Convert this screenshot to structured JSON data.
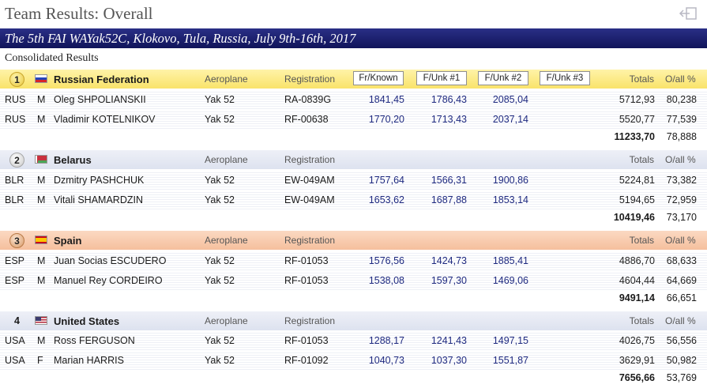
{
  "header": {
    "title": "Team Results: Overall"
  },
  "event": {
    "title": "The 5th FAI WAYak52C, Klokovo, Tula, Russia, July 9th-16th, 2017"
  },
  "subtitle": "Consolidated Results",
  "columns": {
    "aeroplane": "Aeroplane",
    "registration": "Registration",
    "fr_known": "Fr/Known",
    "f_unk1": "F/Unk #1",
    "f_unk2": "F/Unk #2",
    "f_unk3": "F/Unk #3",
    "totals": "Totals",
    "oall_pct": "O/all %"
  },
  "colors": {
    "event_bar": "#10145a",
    "score_blue": "#1f2a80",
    "gold": "#f9e36a",
    "silver": "#dde2ef",
    "bronze": "#f5bf9d"
  },
  "teams": [
    {
      "rank": "1",
      "name": "Russian Federation",
      "flag": "russia-flag",
      "pilots": [
        {
          "code": "RUS",
          "gender": "M",
          "name": "Oleg SHPOLIANSKII",
          "aeroplane": "Yak 52",
          "registration": "RA-0839G",
          "fr_known": "1841,45",
          "f_unk1": "1786,43",
          "f_unk2": "2085,04",
          "total": "5712,93",
          "pct": "80,238"
        },
        {
          "code": "RUS",
          "gender": "M",
          "name": "Vladimir KOTELNIKOV",
          "aeroplane": "Yak 52",
          "registration": "RF-00638",
          "fr_known": "1770,20",
          "f_unk1": "1713,43",
          "f_unk2": "2037,14",
          "total": "5520,77",
          "pct": "77,539"
        }
      ],
      "team_total": "11233,70",
      "team_pct": "78,888"
    },
    {
      "rank": "2",
      "name": "Belarus",
      "flag": "belarus-flag",
      "pilots": [
        {
          "code": "BLR",
          "gender": "M",
          "name": "Dzmitry PASHCHUK",
          "aeroplane": "Yak 52",
          "registration": "EW-049AM",
          "fr_known": "1757,64",
          "f_unk1": "1566,31",
          "f_unk2": "1900,86",
          "total": "5224,81",
          "pct": "73,382"
        },
        {
          "code": "BLR",
          "gender": "M",
          "name": "Vitali SHAMARDZIN",
          "aeroplane": "Yak 52",
          "registration": "EW-049AM",
          "fr_known": "1653,62",
          "f_unk1": "1687,88",
          "f_unk2": "1853,14",
          "total": "5194,65",
          "pct": "72,959"
        }
      ],
      "team_total": "10419,46",
      "team_pct": "73,170"
    },
    {
      "rank": "3",
      "name": "Spain",
      "flag": "spain-flag",
      "pilots": [
        {
          "code": "ESP",
          "gender": "M",
          "name": "Juan Socias ESCUDERO",
          "aeroplane": "Yak 52",
          "registration": "RF-01053",
          "fr_known": "1576,56",
          "f_unk1": "1424,73",
          "f_unk2": "1885,41",
          "total": "4886,70",
          "pct": "68,633"
        },
        {
          "code": "ESP",
          "gender": "M",
          "name": "Manuel Rey CORDEIRO",
          "aeroplane": "Yak 52",
          "registration": "RF-01053",
          "fr_known": "1538,08",
          "f_unk1": "1597,30",
          "f_unk2": "1469,06",
          "total": "4604,44",
          "pct": "64,669"
        }
      ],
      "team_total": "9491,14",
      "team_pct": "66,651"
    },
    {
      "rank": "4",
      "name": "United States",
      "flag": "usa-flag",
      "pilots": [
        {
          "code": "USA",
          "gender": "M",
          "name": "Ross FERGUSON",
          "aeroplane": "Yak 52",
          "registration": "RF-01053",
          "fr_known": "1288,17",
          "f_unk1": "1241,43",
          "f_unk2": "1497,15",
          "total": "4026,75",
          "pct": "56,556"
        },
        {
          "code": "USA",
          "gender": "F",
          "name": "Marian HARRIS",
          "aeroplane": "Yak 52",
          "registration": "RF-01092",
          "fr_known": "1040,73",
          "f_unk1": "1037,30",
          "f_unk2": "1551,87",
          "total": "3629,91",
          "pct": "50,982"
        }
      ],
      "team_total": "7656,66",
      "team_pct": "53,769"
    }
  ]
}
